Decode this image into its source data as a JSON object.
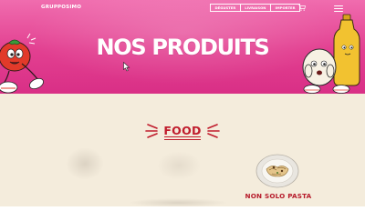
{
  "header": {
    "logo": "GRUPPOSIMO",
    "nav": [
      "DÉGUSTER",
      "LIVRAISON",
      "IMPORTER"
    ],
    "cart_icon": "cart-icon",
    "menu_icon": "hamburger-menu-icon"
  },
  "hero": {
    "title": "NOS PRODUITS",
    "background_color": "#e23f90"
  },
  "section": {
    "heading": "FOOD",
    "products": [
      {
        "name": "NON SOLO PASTA"
      }
    ]
  },
  "colors": {
    "accent_red": "#c01c2c",
    "cream": "#f4ecdc",
    "pink": "#e23f90"
  }
}
